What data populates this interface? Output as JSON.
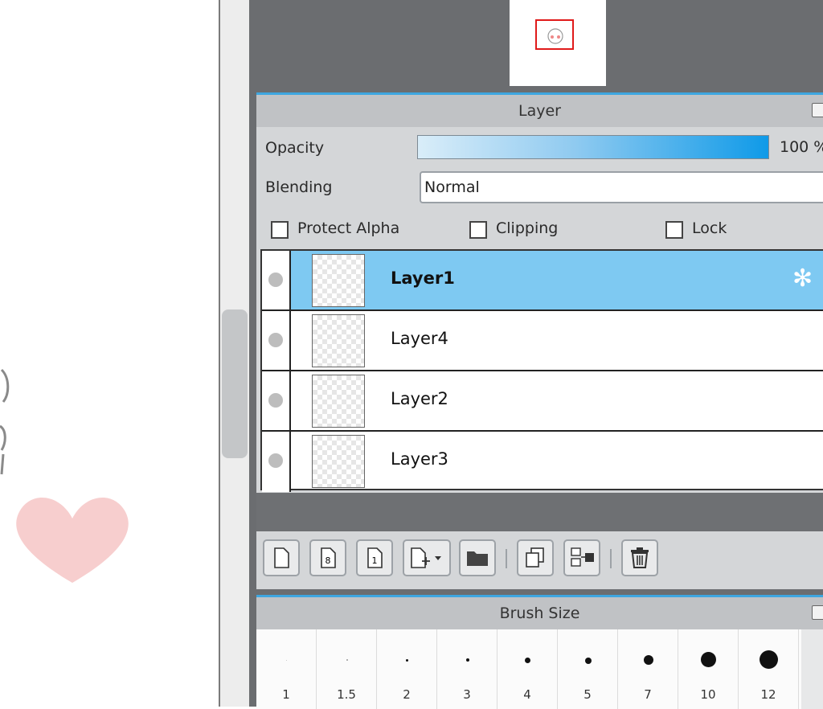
{
  "layer_panel": {
    "title": "Layer",
    "opacity_label": "Opacity",
    "opacity_value_text": "100 %",
    "opacity_value": 100,
    "blending_label": "Blending",
    "blending_value": "Normal",
    "checkboxes": [
      {
        "label": "Protect Alpha",
        "checked": false
      },
      {
        "label": "Clipping",
        "checked": false
      },
      {
        "label": "Lock",
        "checked": false
      }
    ],
    "layers": [
      {
        "name": "Layer1",
        "selected": true
      },
      {
        "name": "Layer4",
        "selected": false
      },
      {
        "name": "Layer2",
        "selected": false
      },
      {
        "name": "Layer3",
        "selected": false
      }
    ],
    "toolbar_icons": [
      "new-layer-icon",
      "new-8bit-layer-icon",
      "new-1bit-layer-icon",
      "add-layer-dropdown-icon",
      "new-folder-icon",
      "duplicate-layer-icon",
      "transfer-layer-icon",
      "delete-layer-icon"
    ]
  },
  "brush_panel": {
    "title": "Brush Size",
    "sizes": [
      "1",
      "1.5",
      "2",
      "3",
      "4",
      "5",
      "7",
      "10",
      "12"
    ]
  },
  "colors": {
    "accent": "#3ea6e0",
    "selected_row": "#7ec9f2",
    "panel_bg": "#d4d6d8",
    "workspace": "#6b6d70"
  }
}
